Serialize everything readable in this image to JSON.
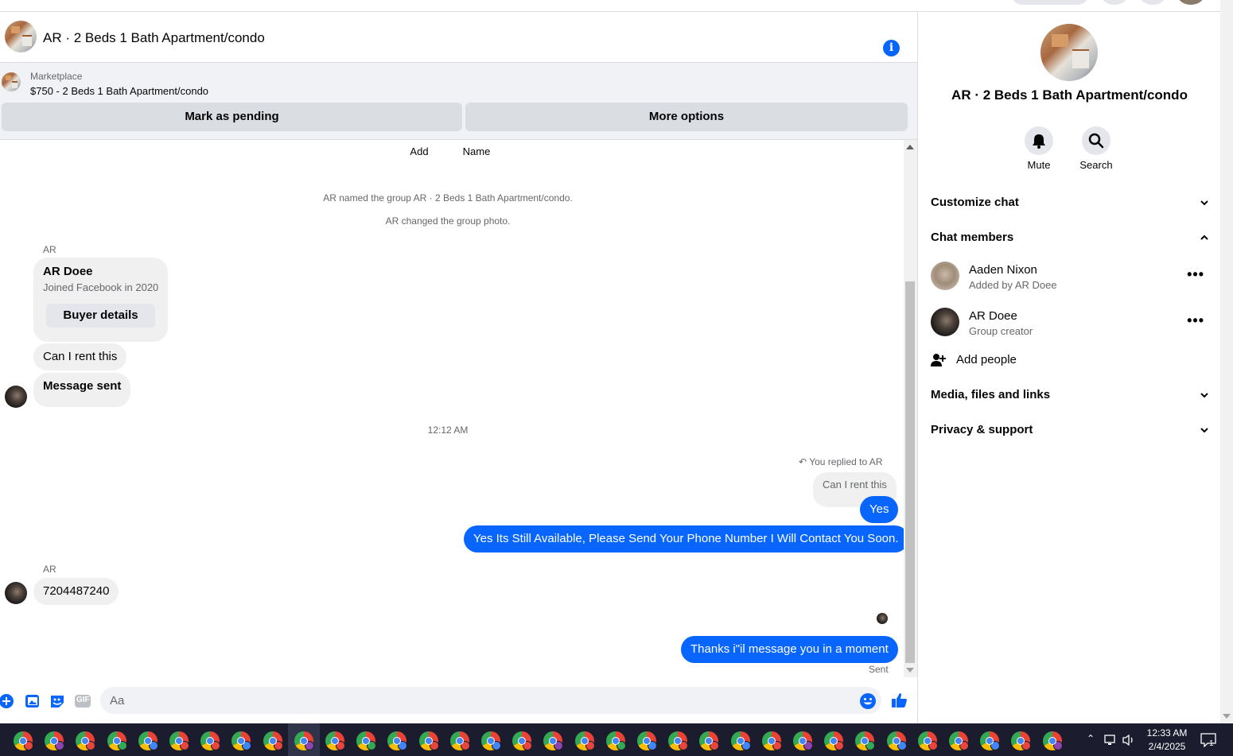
{
  "header": {
    "title": "AR · 2 Beds 1 Bath Apartment/condo",
    "info_icon": "info-icon"
  },
  "marketplace": {
    "label": "Marketplace",
    "listing": "$750 - 2 Beds 1 Bath Apartment/condo",
    "mark_pending": "Mark as pending",
    "more_options": "More options"
  },
  "messages": {
    "actions": [
      "Add",
      "Name"
    ],
    "system": [
      "AR named the group AR · 2 Beds 1 Bath Apartment/condo.",
      "AR changed the group photo."
    ],
    "sender_1": "AR",
    "buyer_card": {
      "name": "AR Doee",
      "joined": "Joined Facebook in 2020",
      "button": "Buyer details"
    },
    "in_1": "Can I rent this",
    "in_2": "Message sent",
    "timestamp": "12:12 AM",
    "replied_label": "You replied to AR",
    "quoted": "Can I rent this",
    "out_1": "Yes",
    "out_2": "Yes Its Still Available, Please Send Your Phone Number I Will Contact You Soon.",
    "sender_2": "AR",
    "in_3": "7204487240",
    "out_3": "Thanks i\"il message you in a moment",
    "status": "Sent"
  },
  "composer": {
    "placeholder": "Aa",
    "icons": [
      "plus-icon",
      "photo-icon",
      "sticker-icon",
      "gif-icon",
      "emoji-icon",
      "like-icon"
    ],
    "gif_label": "GIF"
  },
  "right_panel": {
    "title": "AR · 2 Beds 1 Bath Apartment/condo",
    "mute": "Mute",
    "search": "Search",
    "customize_chat": "Customize chat",
    "chat_members": "Chat members",
    "members": [
      {
        "name": "Aaden Nixon",
        "sub": "Added by AR Doee"
      },
      {
        "name": "AR Doee",
        "sub": "Group creator"
      }
    ],
    "add_people": "Add people",
    "media": "Media, files and links",
    "privacy": "Privacy & support"
  },
  "taskbar": {
    "time": "12:33 AM",
    "date": "2/4/2025",
    "notification_count": "1"
  },
  "colors": {
    "accent": "#0866ff",
    "bubble_in": "#f0f0f0",
    "taskbar": "#1b1d2e"
  }
}
